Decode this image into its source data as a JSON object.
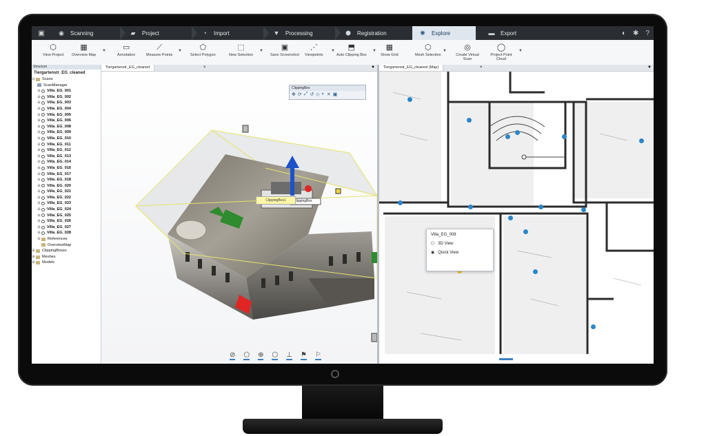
{
  "workflow_tabs": [
    {
      "label": "Scanning",
      "icon": "scanner-icon"
    },
    {
      "label": "Project",
      "icon": "project-icon"
    },
    {
      "label": "Import",
      "icon": "import-icon"
    },
    {
      "label": "Processing",
      "icon": "processing-icon"
    },
    {
      "label": "Registration",
      "icon": "registration-icon"
    },
    {
      "label": "Explore",
      "icon": "explore-icon",
      "active": true
    },
    {
      "label": "Export",
      "icon": "export-icon"
    }
  ],
  "ribbon": [
    {
      "label": "View Project",
      "icon": "cube-icon"
    },
    {
      "label": "Overview Map",
      "icon": "map-icon"
    },
    {
      "label": "Annotation",
      "icon": "annotation-icon"
    },
    {
      "label": "Measure Points",
      "icon": "measure-icon"
    },
    {
      "label": "Select Polygon",
      "icon": "polygon-icon"
    },
    {
      "label": "New Selection",
      "icon": "selection-icon"
    },
    {
      "label": "Save Screenshot",
      "icon": "screenshot-icon"
    },
    {
      "label": "Viewpoints",
      "icon": "viewpoints-icon"
    },
    {
      "label": "Auto Clipping Box",
      "icon": "clipping-box-icon"
    },
    {
      "label": "Show Grid",
      "icon": "grid-icon"
    },
    {
      "label": "Mesh Selection",
      "icon": "mesh-icon"
    },
    {
      "label": "Create Virtual Scan",
      "icon": "virtual-scan-icon"
    },
    {
      "label": "Project Point Cloud",
      "icon": "point-cloud-icon"
    }
  ],
  "tree": {
    "panel_header": "Structure",
    "project_name": "Tiergartenstr_EG_cleaned",
    "scans_label": "Scans",
    "scan_manager": "ScanManager",
    "scans": [
      "Villa_EG_001",
      "Villa_EG_002",
      "Villa_EG_003",
      "Villa_EG_004",
      "Villa_EG_005",
      "Villa_EG_006",
      "Villa_EG_008",
      "Villa_EG_009",
      "Villa_EG_010",
      "Villa_EG_011",
      "Villa_EG_012",
      "Villa_EG_013",
      "Villa_EG_014",
      "Villa_EG_016",
      "Villa_EG_017",
      "Villa_EG_018",
      "Villa_EG_020",
      "Villa_EG_021",
      "Villa_EG_022",
      "Villa_EG_023",
      "Villa_EG_024",
      "Villa_EG_025",
      "Villa_EG_026",
      "Villa_EG_027",
      "Villa_EG_028"
    ],
    "bottom_items": [
      "References",
      "OverviewMap",
      "ClippingBoxes",
      "Meshes",
      "Models"
    ]
  },
  "view3d": {
    "tab_label": "Tiergartenstr_EG_cleaned",
    "clipping_toolbar_title": "ClippingBox",
    "tooltip": "ClippingBox1",
    "label_on_model": "ClippingBox"
  },
  "viewmap": {
    "tab_label": "Tiergartenstr_EG_cleaned (Map)",
    "popup": {
      "title": "Villa_EG_008",
      "action_3d": "3D View",
      "action_quick": "Quick View"
    },
    "scan_points_color": "#2a86c9",
    "selected_point_color": "#f2c21b"
  },
  "colors": {
    "workflow_bar": "#2a2e33",
    "active_tab": "#dfe6ee",
    "clipping_box_line": "#e5e36a"
  }
}
